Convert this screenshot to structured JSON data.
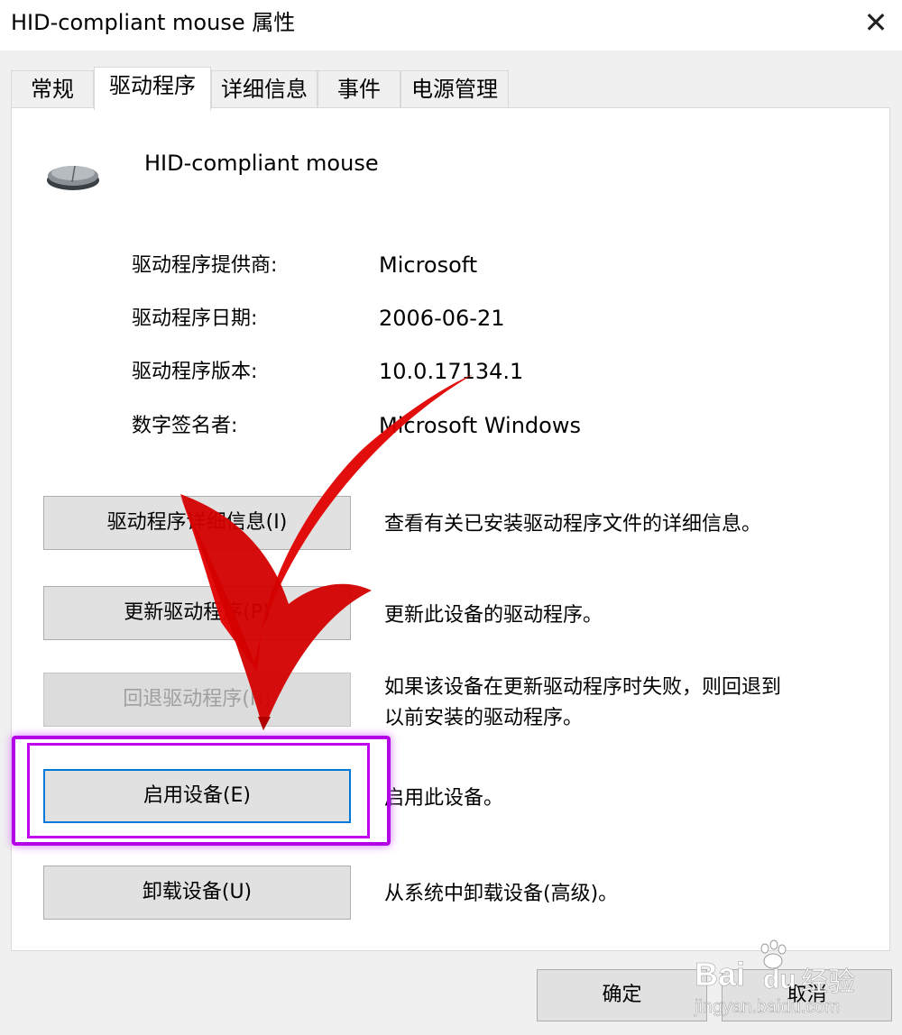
{
  "window": {
    "title": "HID-compliant mouse 属性",
    "close_glyph": "✕"
  },
  "tabs": [
    {
      "label": "常规",
      "active": false
    },
    {
      "label": "驱动程序",
      "active": true
    },
    {
      "label": "详细信息",
      "active": false
    },
    {
      "label": "事件",
      "active": false
    },
    {
      "label": "电源管理",
      "active": false
    }
  ],
  "device": {
    "icon": "mouse-icon",
    "name": "HID-compliant mouse"
  },
  "driver_info": [
    {
      "label": "驱动程序提供商:",
      "value": "Microsoft"
    },
    {
      "label": "驱动程序日期:",
      "value": "2006-06-21"
    },
    {
      "label": "驱动程序版本:",
      "value": "10.0.17134.1"
    },
    {
      "label": "数字签名者:",
      "value": "Microsoft Windows"
    }
  ],
  "actions": [
    {
      "button": "驱动程序详细信息(I)",
      "description": "查看有关已安装驱动程序文件的详细信息。",
      "enabled": true
    },
    {
      "button": "更新驱动程序(P)",
      "description": "更新此设备的驱动程序。",
      "enabled": true
    },
    {
      "button": "回退驱动程序(R)",
      "description": "如果该设备在更新驱动程序时失败，则回退到以前安装的驱动程序。",
      "description_line1": "如果该设备在更新驱动程序时失败，则回退到",
      "description_line2": "以前安装的驱动程序。",
      "enabled": false
    },
    {
      "button": "启用设备(E)",
      "description": "启用此设备。",
      "enabled": true,
      "focused": true
    },
    {
      "button": "卸载设备(U)",
      "description": "从系统中卸载设备(高级)。",
      "enabled": true
    }
  ],
  "footer": {
    "ok_label": "确定",
    "cancel_label": "取消"
  },
  "annotation": {
    "arrow_color": "#e00000",
    "highlight_color": "#b400e6"
  },
  "watermark": {
    "brand": "Bai",
    "brand2": "du",
    "suffix": "经验",
    "url": "jingyan.baidu.com"
  }
}
